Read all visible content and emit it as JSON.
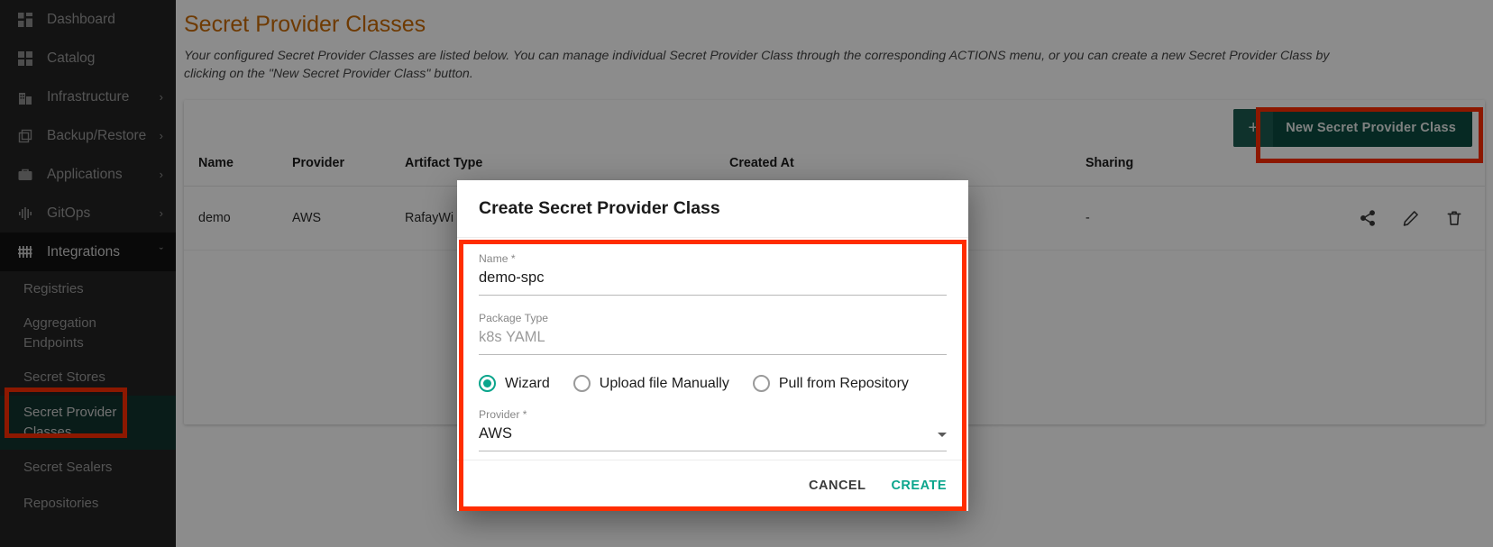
{
  "sidebar": {
    "items": [
      {
        "label": "Dashboard",
        "icon": "dashboard-icon",
        "expandable": false
      },
      {
        "label": "Catalog",
        "icon": "catalog-icon",
        "expandable": false
      },
      {
        "label": "Infrastructure",
        "icon": "infrastructure-icon",
        "expandable": true,
        "chevron": "›"
      },
      {
        "label": "Backup/Restore",
        "icon": "backup-restore-icon",
        "expandable": true,
        "chevron": "›"
      },
      {
        "label": "Applications",
        "icon": "applications-icon",
        "expandable": true,
        "chevron": "›"
      },
      {
        "label": "GitOps",
        "icon": "gitops-icon",
        "expandable": true,
        "chevron": "›"
      },
      {
        "label": "Integrations",
        "icon": "integrations-icon",
        "expandable": true,
        "chevron": "ˇ",
        "active": true
      }
    ],
    "sub_items": [
      {
        "label": "Registries"
      },
      {
        "label": "Aggregation Endpoints"
      },
      {
        "label": "Secret Stores"
      },
      {
        "label": "Secret Provider Classes",
        "selected": true
      },
      {
        "label": "Secret Sealers"
      },
      {
        "label": "Repositories"
      }
    ]
  },
  "page": {
    "title": "Secret Provider Classes",
    "description": "Your configured Secret Provider Classes are listed below. You can manage individual Secret Provider Class through the corresponding ACTIONS menu, or you can create a new Secret Provider Class by clicking on the \"New Secret Provider Class\" button."
  },
  "toolbar": {
    "new_button_label": "New Secret Provider Class",
    "new_button_plus": "+"
  },
  "table": {
    "columns": [
      "Name",
      "Provider",
      "Artifact Type",
      "Created At",
      "Sharing"
    ],
    "rows": [
      {
        "name": "demo",
        "provider": "AWS",
        "artifact_type": "RafayWi",
        "created_at": "",
        "sharing": "-"
      }
    ],
    "row_actions": [
      "share-icon",
      "edit-icon",
      "delete-icon"
    ]
  },
  "modal": {
    "title": "Create Secret Provider Class",
    "fields": {
      "name": {
        "label": "Name *",
        "value": "demo-spc"
      },
      "package_type": {
        "label": "Package Type",
        "placeholder": "k8s YAML"
      },
      "provider": {
        "label": "Provider *",
        "value": "AWS"
      }
    },
    "source_options": [
      {
        "label": "Wizard",
        "selected": true
      },
      {
        "label": "Upload file Manually",
        "selected": false
      },
      {
        "label": "Pull from Repository",
        "selected": false
      }
    ],
    "cancel_label": "CANCEL",
    "create_label": "CREATE"
  },
  "colors": {
    "accent_orange": "#c96a04",
    "teal": "#0aa58c",
    "button_green": "#0c4b41",
    "highlight_red": "#ff2d00",
    "sidebar_bg": "#232323",
    "sidebar_selected": "#12332e"
  }
}
